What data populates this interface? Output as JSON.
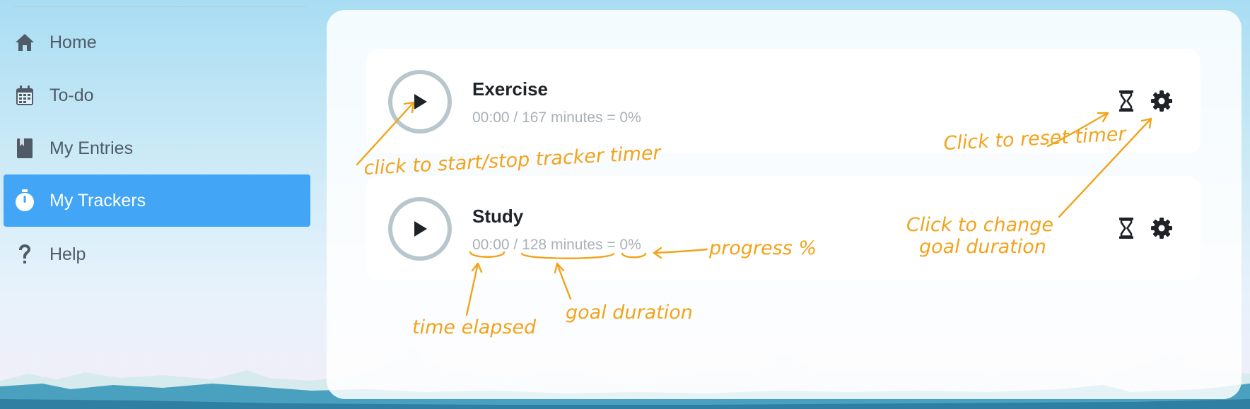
{
  "sidebar": {
    "items": [
      {
        "label": "Home",
        "icon": "home-icon",
        "active": false
      },
      {
        "label": "To-do",
        "icon": "calendar-icon",
        "active": false
      },
      {
        "label": "My Entries",
        "icon": "book-icon",
        "active": false
      },
      {
        "label": "My Trackers",
        "icon": "stopwatch-icon",
        "active": true
      },
      {
        "label": "Help",
        "icon": "question-icon",
        "active": false
      }
    ]
  },
  "trackers": [
    {
      "name": "Exercise",
      "elapsed": "00:00",
      "goal": "167 minutes",
      "progress": "0%"
    },
    {
      "name": "Study",
      "elapsed": "00:00",
      "goal": "128 minutes",
      "progress": "0%"
    }
  ],
  "annotations": {
    "start_stop": "click to start/stop tracker timer",
    "reset": "Click to reset timer",
    "change_goal_line1": "Click to change",
    "change_goal_line2": "goal duration",
    "progress": "progress %",
    "time_elapsed": "time elapsed",
    "goal_duration": "goal duration"
  },
  "colors": {
    "accent": "#42a5f5",
    "annotation": "#f2a31b",
    "nav_text": "#4f5b66",
    "muted_text": "#a9b1b8"
  }
}
